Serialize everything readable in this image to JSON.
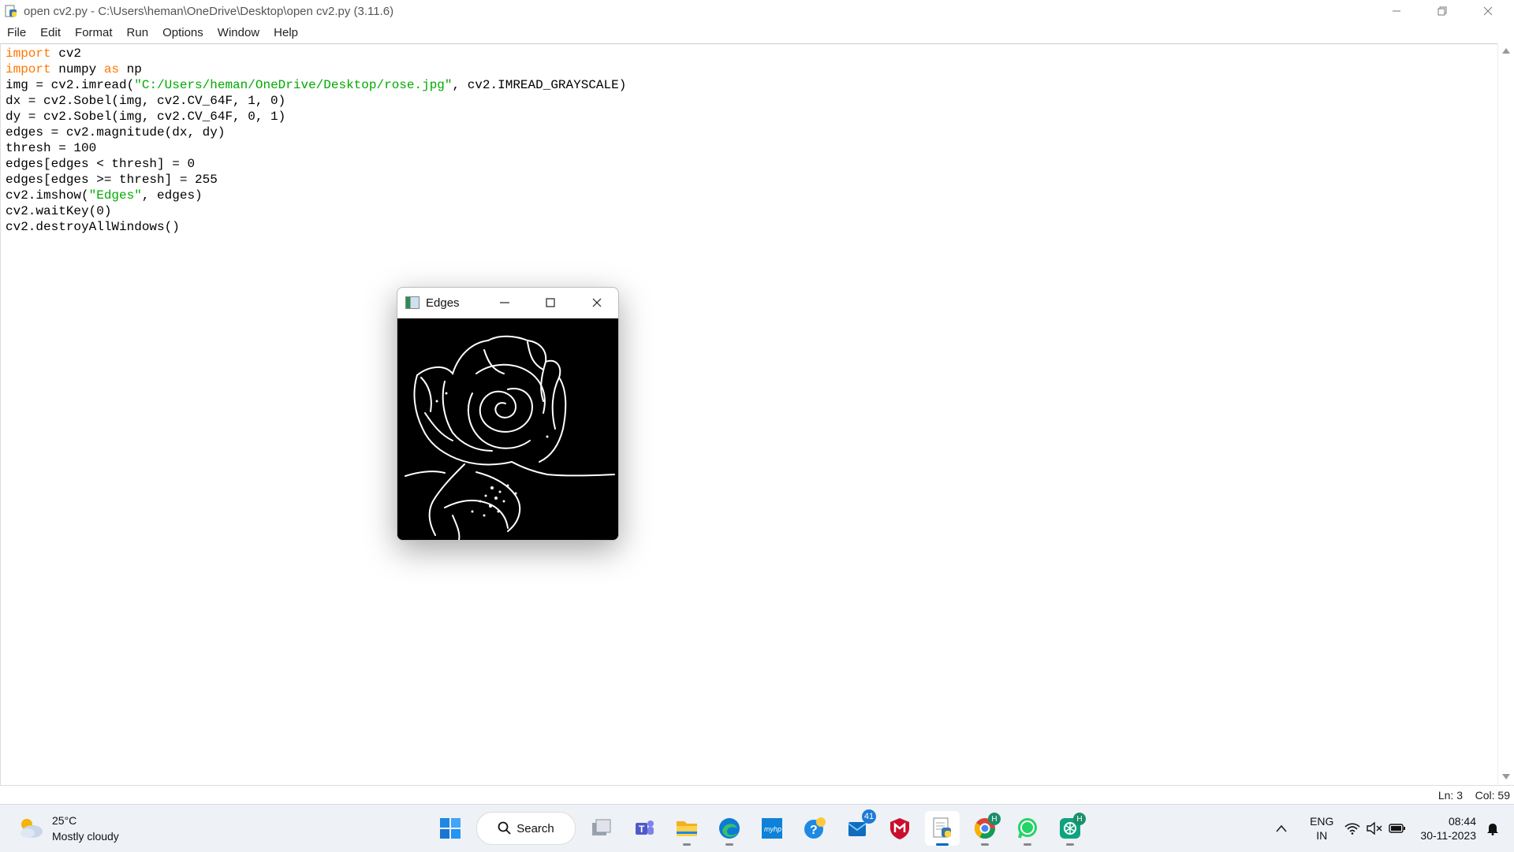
{
  "window": {
    "title": "open cv2.py - C:\\Users\\heman\\OneDrive\\Desktop\\open cv2.py (3.11.6)",
    "minimize_icon": "minimize-icon",
    "restore_icon": "restore-icon",
    "close_icon": "close-icon"
  },
  "menu": {
    "items": [
      "File",
      "Edit",
      "Format",
      "Run",
      "Options",
      "Window",
      "Help"
    ]
  },
  "code": {
    "lines": [
      {
        "parts": [
          {
            "t": "import",
            "c": "kw"
          },
          {
            "t": " cv2"
          }
        ]
      },
      {
        "parts": [
          {
            "t": "import",
            "c": "kw"
          },
          {
            "t": " numpy "
          },
          {
            "t": "as",
            "c": "kw"
          },
          {
            "t": " np"
          }
        ]
      },
      {
        "parts": [
          {
            "t": "img = cv2.imread("
          },
          {
            "t": "\"C:/Users/heman/OneDrive/Desktop/rose.jpg\"",
            "c": "str"
          },
          {
            "t": ", cv2.IMREAD_GRAYSCALE)"
          }
        ]
      },
      {
        "parts": [
          {
            "t": "dx = cv2.Sobel(img, cv2.CV_64F, 1, 0)"
          }
        ]
      },
      {
        "parts": [
          {
            "t": "dy = cv2.Sobel(img, cv2.CV_64F, 0, 1)"
          }
        ]
      },
      {
        "parts": [
          {
            "t": "edges = cv2.magnitude(dx, dy)"
          }
        ]
      },
      {
        "parts": [
          {
            "t": "thresh = 100"
          }
        ]
      },
      {
        "parts": [
          {
            "t": "edges[edges < thresh] = 0"
          }
        ]
      },
      {
        "parts": [
          {
            "t": "edges[edges >= thresh] = 255"
          }
        ]
      },
      {
        "parts": [
          {
            "t": "cv2.imshow("
          },
          {
            "t": "\"Edges\"",
            "c": "str"
          },
          {
            "t": ", edges)"
          }
        ]
      },
      {
        "parts": [
          {
            "t": "cv2.waitKey(0)"
          }
        ]
      },
      {
        "parts": [
          {
            "t": "cv2.destroyAllWindows()"
          }
        ]
      }
    ]
  },
  "status": {
    "ln": "Ln: 3",
    "col": "Col: 59"
  },
  "edges_window": {
    "title": "Edges"
  },
  "taskbar": {
    "weather_temp": "25°C",
    "weather_desc": "Mostly cloudy",
    "search_label": "Search",
    "outlook_badge": "41",
    "chrome_badge": "H",
    "chatgpt_badge": "H",
    "lang_top": "ENG",
    "lang_bottom": "IN",
    "time": "08:44",
    "date": "30-11-2023"
  },
  "colors": {
    "keyword": "#ff7700",
    "string": "#00aa00",
    "accent": "#0067c0"
  }
}
